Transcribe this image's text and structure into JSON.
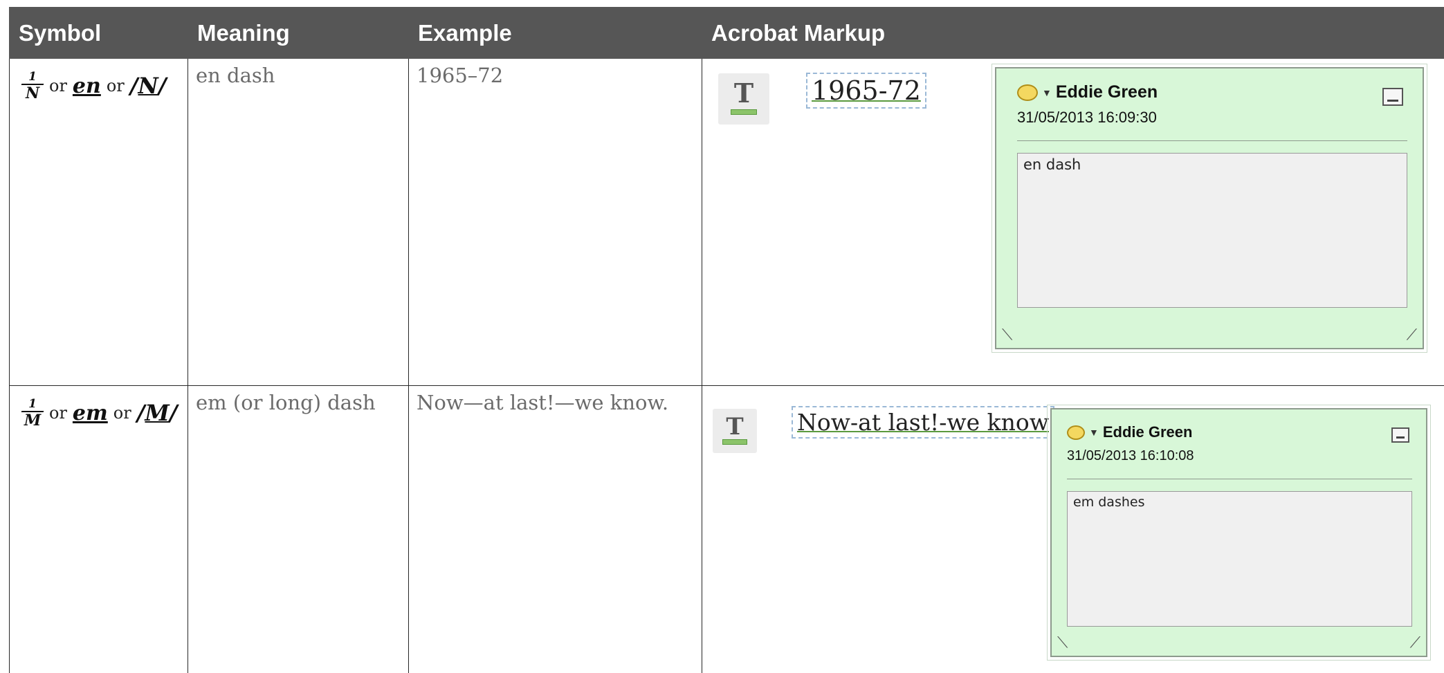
{
  "headers": {
    "symbol": "Symbol",
    "meaning": "Meaning",
    "example": "Example",
    "acrobat": "Acrobat Markup"
  },
  "rows": [
    {
      "symbol": {
        "fraction_top": "1",
        "fraction_bottom": "N",
        "or1": "or",
        "word": "en",
        "or2": "or",
        "slashed": "N"
      },
      "meaning": "en dash",
      "example": "1965–72",
      "markup_text": "1965-72",
      "note": {
        "author": "Eddie Green",
        "date": "31/05/2013 16:09:30",
        "comment": "en dash"
      }
    },
    {
      "symbol": {
        "fraction_top": "1",
        "fraction_bottom": "M",
        "or1": "or",
        "word": "em",
        "or2": "or",
        "slashed": "M"
      },
      "meaning": "em (or long) dash",
      "example": "Now—at last!—we know.",
      "markup_text": "Now-at last!-we know",
      "note": {
        "author": "Eddie Green",
        "date": "31/05/2013 16:10:08",
        "comment": "em dashes"
      }
    }
  ],
  "icons": {
    "tool": "text-underline-tool-icon",
    "comment": "comment-bubble-icon",
    "minimize": "minimize-icon",
    "resize": "resize-grip-icon"
  },
  "colors": {
    "header_bg": "#565656",
    "note_bg": "#d8f7d8",
    "markup_underline": "#5a9a3e"
  }
}
